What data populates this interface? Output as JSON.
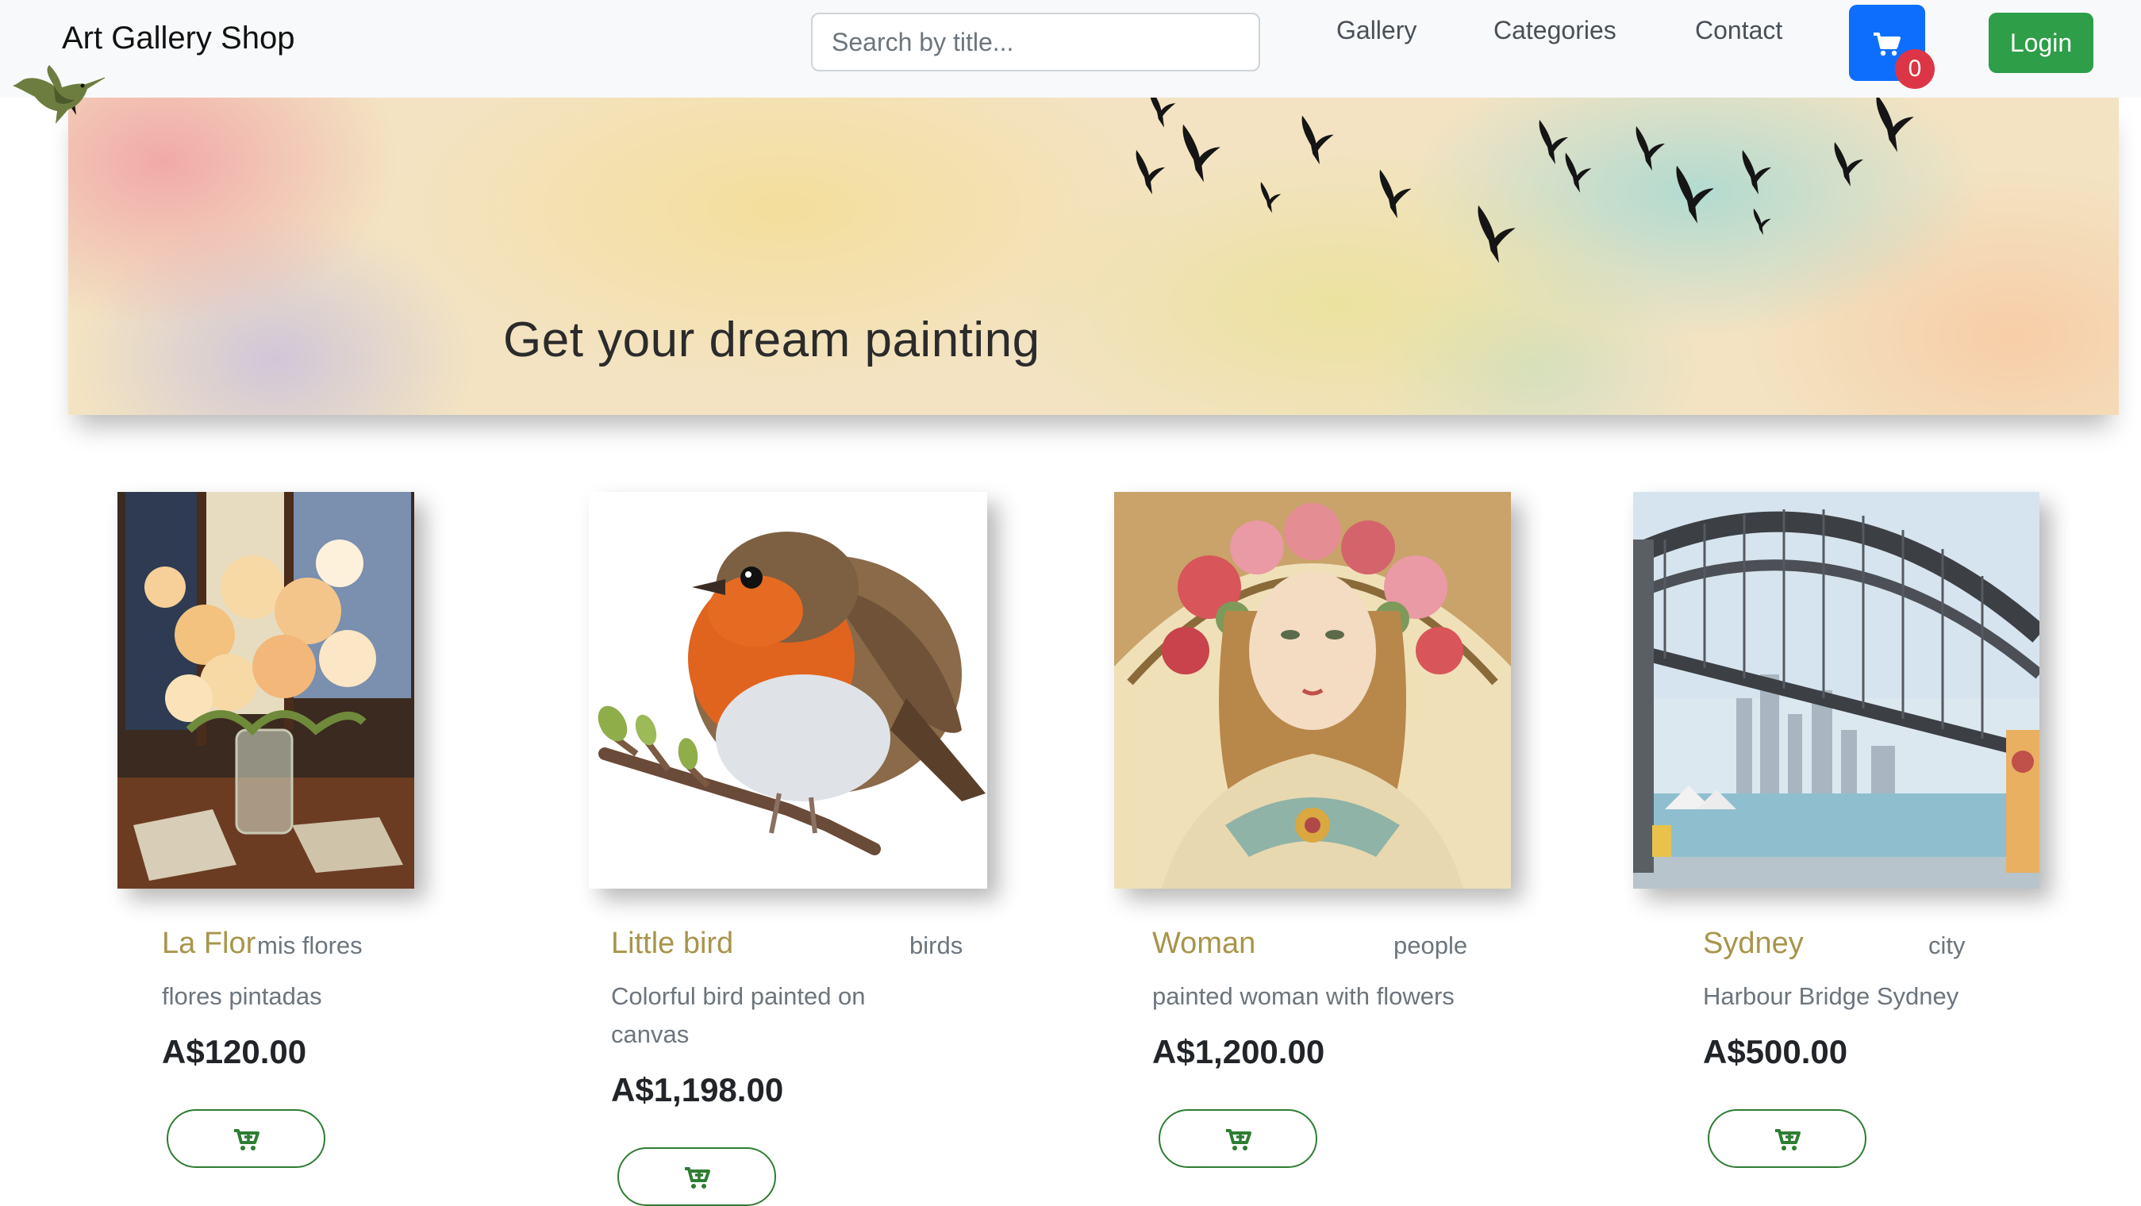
{
  "navbar": {
    "brand": "Art Gallery Shop",
    "brand_icon": "hummingbird-icon",
    "search_placeholder": "Search by title...",
    "links": [
      "Gallery",
      "Categories",
      "Contact"
    ],
    "cart_count": "0",
    "login_label": "Login"
  },
  "hero": {
    "title": "Get your dream painting"
  },
  "products": [
    {
      "title": "La Flor",
      "category": "mis flores",
      "description": "flores pintadas",
      "price": "A$120.00",
      "image": "flowers-vase-painting"
    },
    {
      "title": "Little bird",
      "category": "birds",
      "description": "Colorful bird painted on canvas",
      "price": "A$1,198.00",
      "image": "robin-painting"
    },
    {
      "title": "Woman",
      "category": "people",
      "description": "painted woman with flowers",
      "price": "A$1,200.00",
      "image": "art-nouveau-woman-painting"
    },
    {
      "title": "Sydney",
      "category": "city",
      "description": "Harbour Bridge Sydney",
      "price": "A$500.00",
      "image": "harbour-bridge-painting"
    }
  ],
  "colors": {
    "nav_bg": "#f8f9fa",
    "cart_blue": "#0d6efd",
    "badge_red": "#dc3545",
    "login_green": "#2e9e48",
    "title_gold": "#a8954a",
    "button_green": "#2e7d32"
  }
}
